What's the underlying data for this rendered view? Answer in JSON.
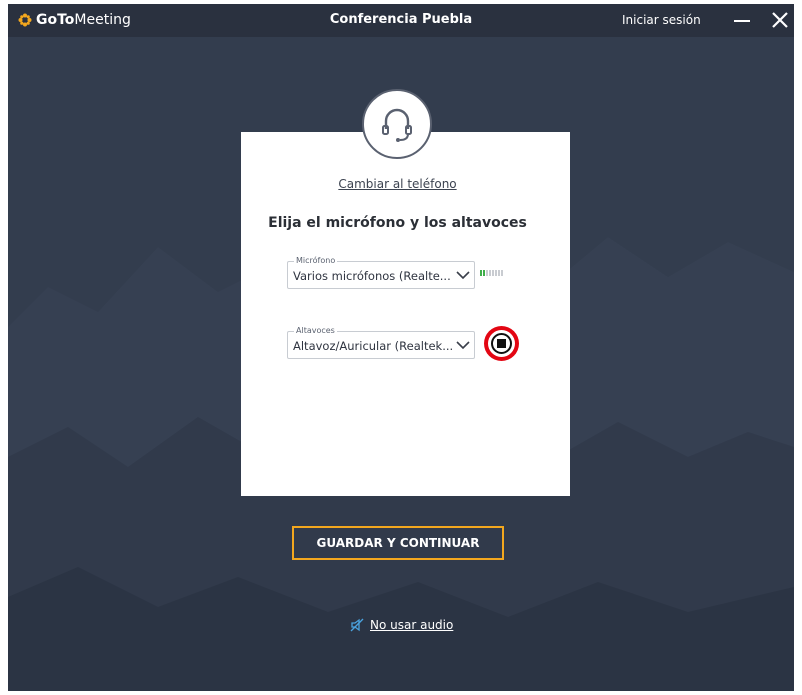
{
  "app": {
    "brand_goto": "GoTo",
    "brand_meeting": "Meeting",
    "window_title": "Conferencia Puebla",
    "sign_in_label": "Iniciar sesión"
  },
  "audio_setup": {
    "switch_to_phone_link": "Cambiar al teléfono",
    "heading": "Elija el micrófono y los altavoces",
    "microphone": {
      "label": "Micrófono",
      "selected": "Varios micrófonos (Realte..."
    },
    "speakers": {
      "label": "Altavoces",
      "selected": "Altavoz/Auricular (Realtek..."
    },
    "save_button": "GUARDAR Y CONTINUAR",
    "no_audio_link": "No usar audio"
  },
  "colors": {
    "background": "#333d4e",
    "titlebar": "#2a313f",
    "accent_orange": "#f3a71e",
    "highlight_red": "#e30613",
    "link_blue": "#4aa3df",
    "level_green": "#3fae49"
  },
  "icons": {
    "brand": "gotomeeting-logo-icon",
    "avatar": "headset-icon",
    "dropdown": "chevron-down-icon",
    "test_speaker": "stop-icon",
    "no_audio": "muted-speaker-icon",
    "minimize": "minimize-icon",
    "close": "close-icon"
  }
}
